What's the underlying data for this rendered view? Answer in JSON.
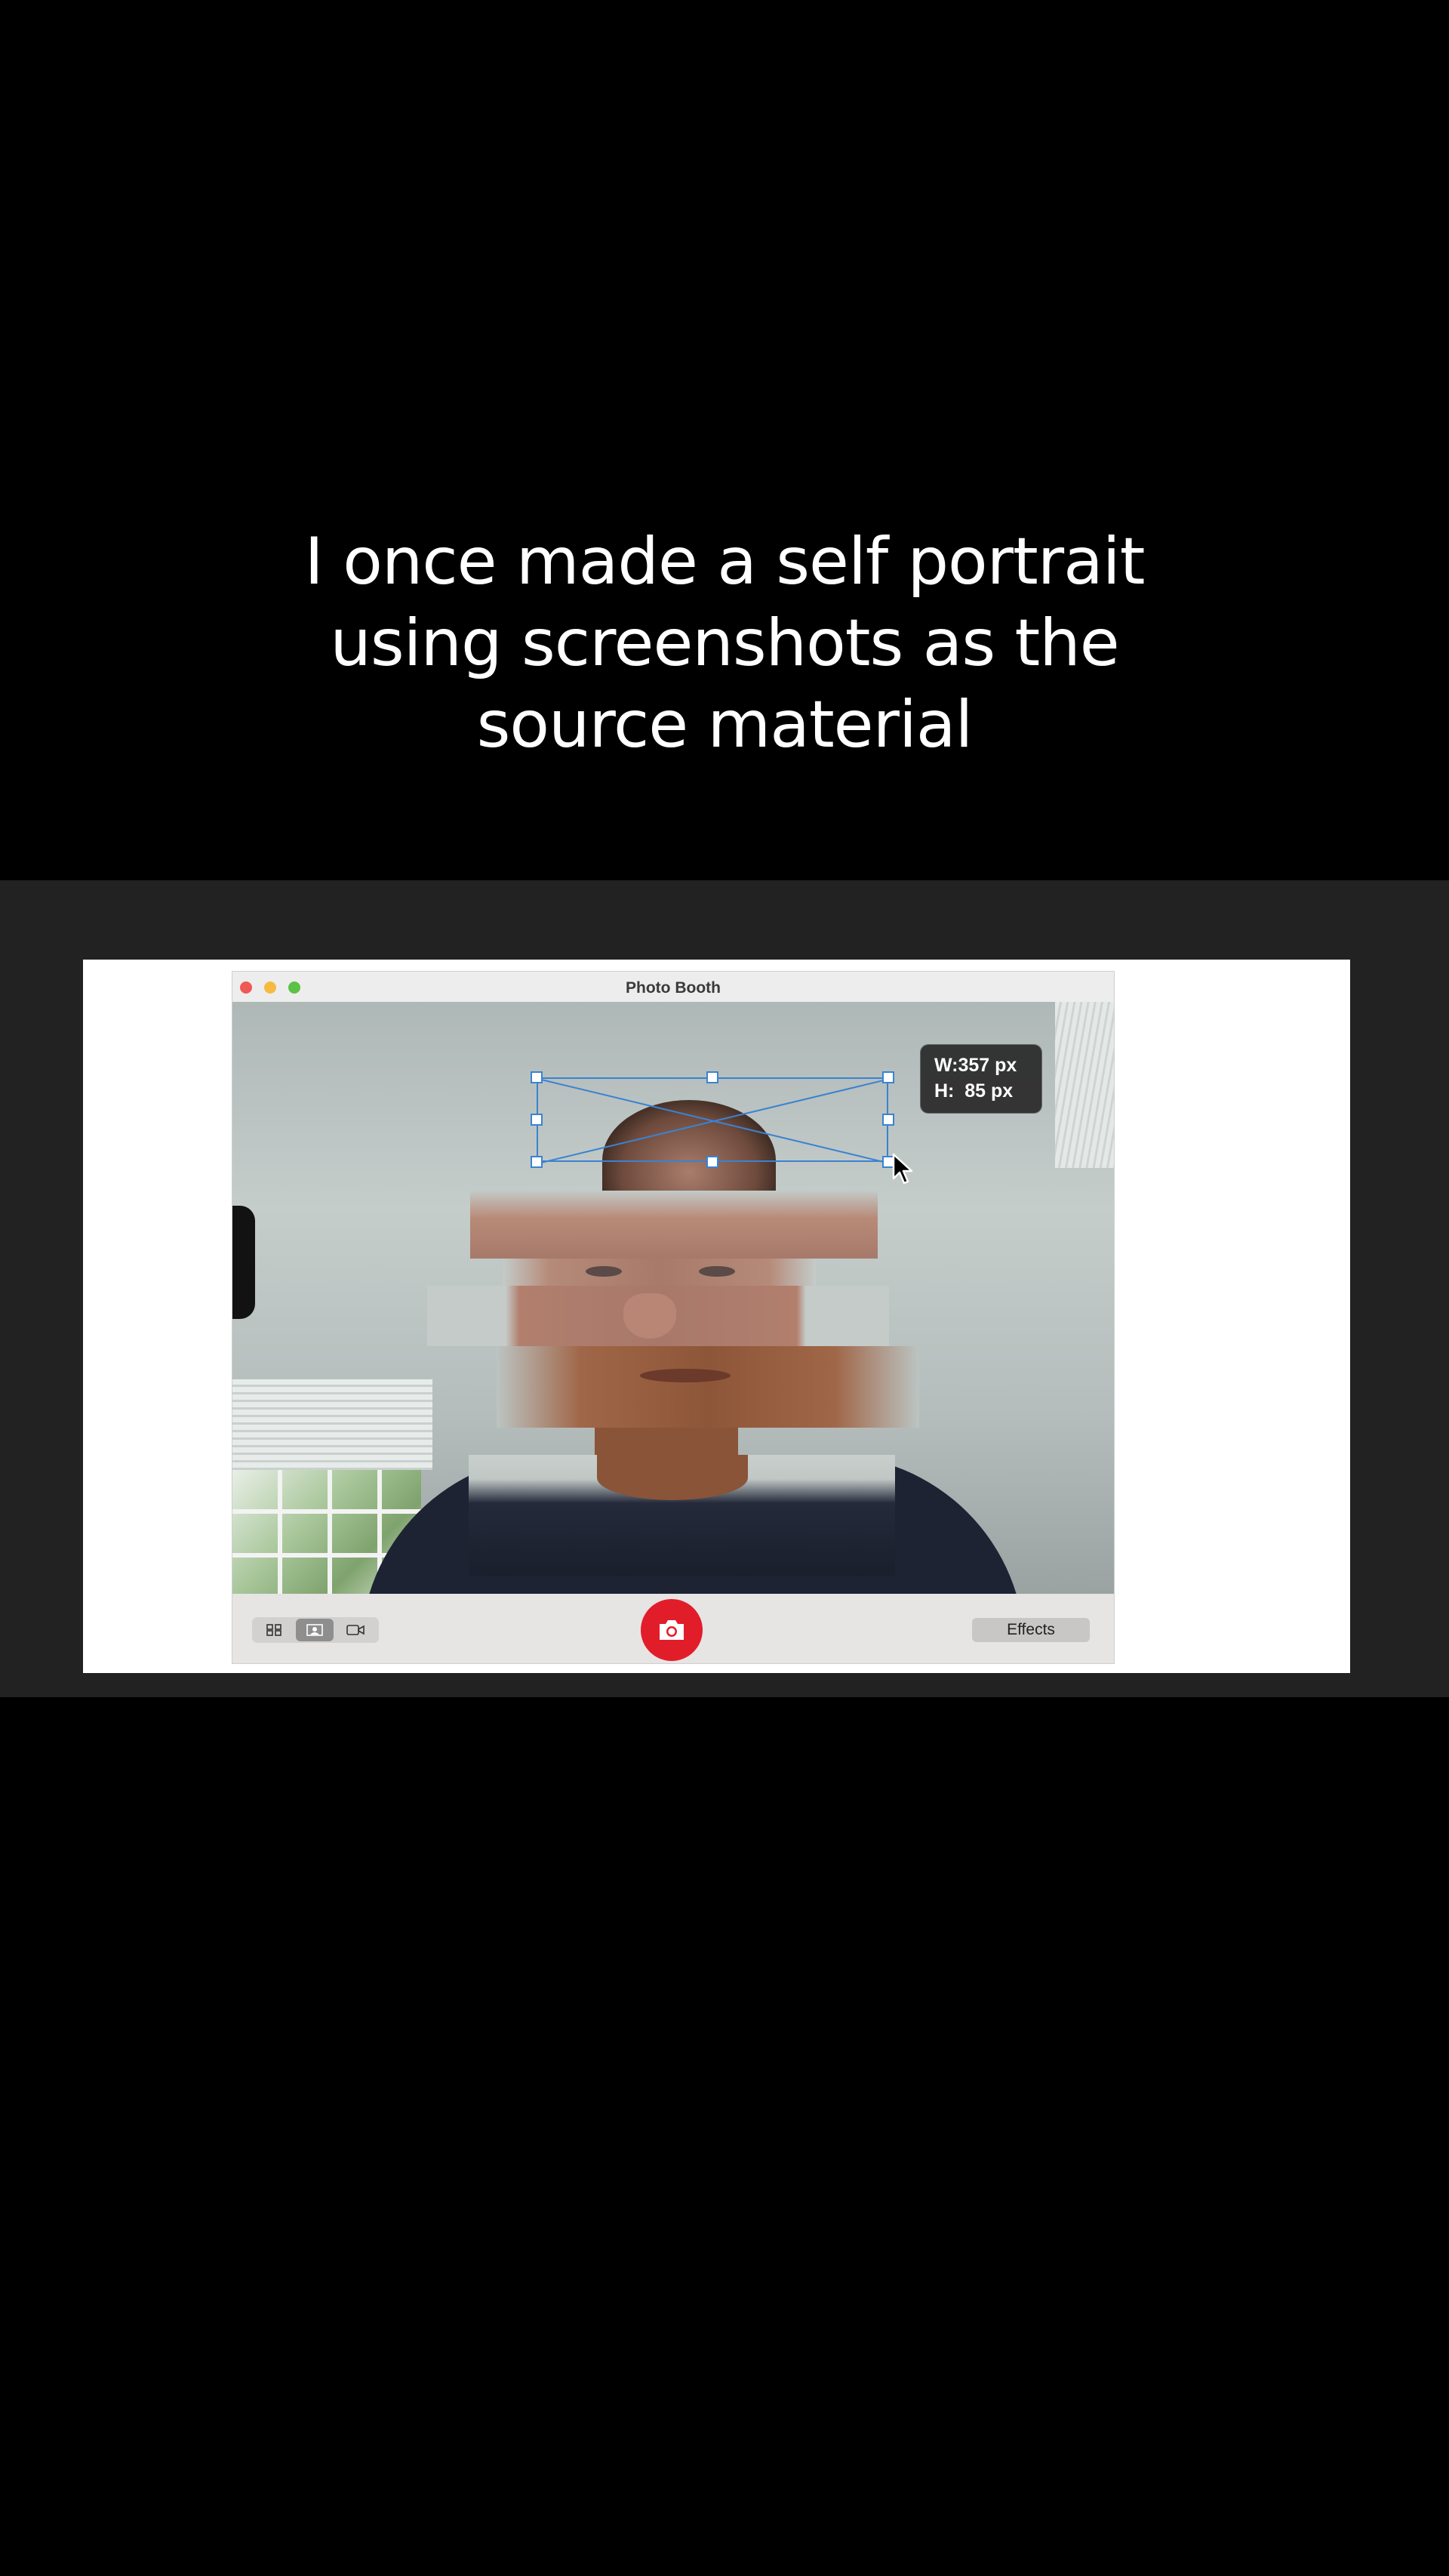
{
  "caption": {
    "line1": "I once made a self portrait",
    "line2": "using screenshots as the",
    "line3": "source material"
  },
  "window": {
    "title": "Photo Booth"
  },
  "selection": {
    "width_label": "W:357 px",
    "height_label": "H:  85 px"
  },
  "toolbar": {
    "effects_label": "Effects",
    "view_modes": [
      "grid-view-icon",
      "single-photo-icon",
      "video-icon"
    ],
    "active_mode": "single-photo-icon"
  },
  "colors": {
    "shutter": "#e21d2a",
    "selection": "#3b82d0",
    "close": "#ee5a55",
    "minimize": "#f4bb40",
    "zoom": "#5cc245"
  }
}
